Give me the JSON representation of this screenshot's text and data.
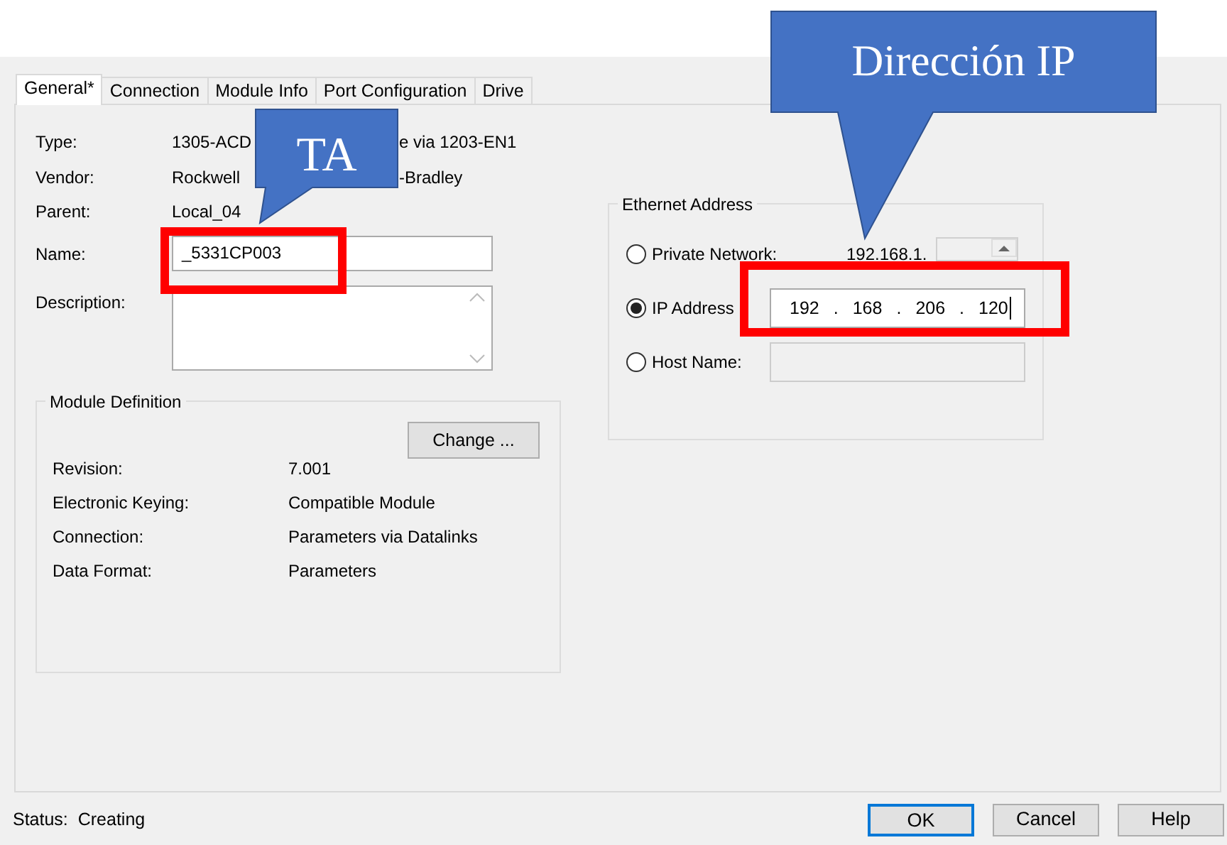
{
  "tabs": [
    {
      "label": "General*",
      "selected": true
    },
    {
      "label": "Connection",
      "selected": false
    },
    {
      "label": "Module Info",
      "selected": false
    },
    {
      "label": "Port Configuration",
      "selected": false
    },
    {
      "label": "Drive",
      "selected": false
    }
  ],
  "general": {
    "fields": [
      {
        "label": "Type:",
        "value_parts": [
          "1305-ACD",
          "e via 1203-EN1"
        ]
      },
      {
        "label": "Vendor:",
        "value_parts": [
          "Rockwell",
          "-Bradley"
        ]
      },
      {
        "label": "Parent:",
        "value_parts": [
          "Local_04"
        ]
      }
    ],
    "name": {
      "label": "Name:",
      "value": "_5331CP003"
    },
    "description": {
      "label": "Description:"
    }
  },
  "module_definition": {
    "title": "Module Definition",
    "button": "Change ...",
    "rows": [
      {
        "label": "Revision:",
        "value": "7.001"
      },
      {
        "label": "Electronic Keying:",
        "value": "Compatible Module"
      },
      {
        "label": "Connection:",
        "value": "Parameters via Datalinks"
      },
      {
        "label": "Data Format:",
        "value": "Parameters"
      }
    ]
  },
  "ethernet_address": {
    "title": "Ethernet Address",
    "options": [
      {
        "kind": "private",
        "label": "Private Network:",
        "prefix": "192.168.1.",
        "selected": false
      },
      {
        "kind": "ip",
        "label": "IP Address",
        "octets": [
          "192",
          "168",
          "206",
          "120"
        ],
        "separator": ".",
        "selected": true
      },
      {
        "kind": "host",
        "label": "Host Name:",
        "selected": false
      }
    ]
  },
  "status": {
    "label": "Status:",
    "value": "Creating"
  },
  "buttons": [
    {
      "label": "OK",
      "default": true
    },
    {
      "label": "Cancel",
      "default": false
    },
    {
      "label": "Help",
      "default": false
    }
  ],
  "annotations": [
    {
      "kind": "callout",
      "text": "TA"
    },
    {
      "kind": "callout",
      "text": "Dirección IP"
    },
    {
      "kind": "highlight"
    },
    {
      "kind": "highlight"
    }
  ]
}
